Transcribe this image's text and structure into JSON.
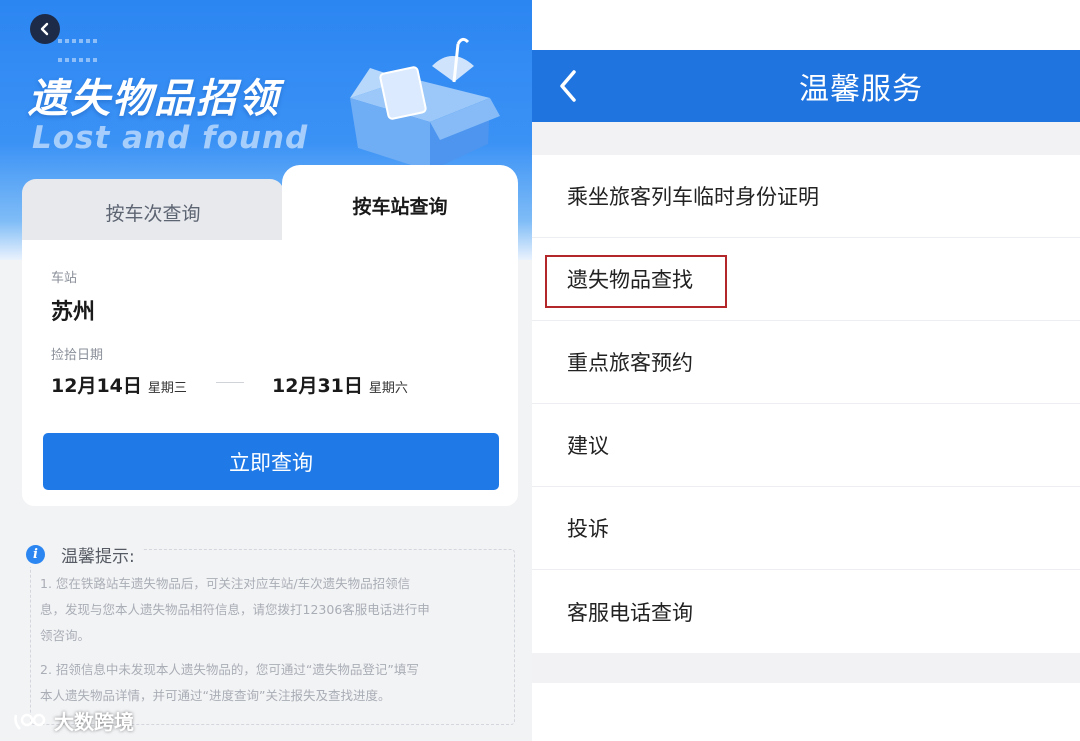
{
  "left": {
    "hero": {
      "title": "遗失物品招领",
      "subtitle": "Lost and found"
    },
    "tabs": [
      {
        "label": "按车次查询",
        "selected": false
      },
      {
        "label": "按车站查询",
        "selected": true
      }
    ],
    "form": {
      "station_label": "车站",
      "station_value": "苏州",
      "date_label": "捡拾日期",
      "start_date": "12月14日",
      "start_weekday": "星期三",
      "end_date": "12月31日",
      "end_weekday": "星期六",
      "query_button": "立即查询"
    },
    "tips": {
      "title": "温馨提示:",
      "lines": [
        "1. 您在铁路站车遗失物品后，可关注对应车站/车次遗失物品招领信",
        "息，发现与您本人遗失物品相符信息，请您拨打12306客服电话进行申",
        "领咨询。",
        "2. 招领信息中未发现本人遗失物品的，您可通过“遗失物品登记”填写",
        "本人遗失物品详情，并可通过“进度查询”关注报失及查找进度。"
      ]
    },
    "watermark": "大数跨境"
  },
  "right": {
    "nav_title": "温馨服务",
    "items": [
      {
        "label": "乘坐旅客列车临时身份证明",
        "highlighted": false
      },
      {
        "label": "遗失物品查找",
        "highlighted": true
      },
      {
        "label": "重点旅客预约",
        "highlighted": false
      },
      {
        "label": "建议",
        "highlighted": false
      },
      {
        "label": "投诉",
        "highlighted": false
      },
      {
        "label": "客服电话查询",
        "highlighted": false
      }
    ],
    "highlight_color": "#b3262a"
  },
  "colors": {
    "brand_blue": "#1f74e0",
    "button_blue": "#1f7ae8",
    "hero_blue": "#2c86f2"
  },
  "icons": {
    "back": "chevron-left-icon",
    "info": "info-icon",
    "box_illustration": "open-box-umbrella-illustration"
  }
}
